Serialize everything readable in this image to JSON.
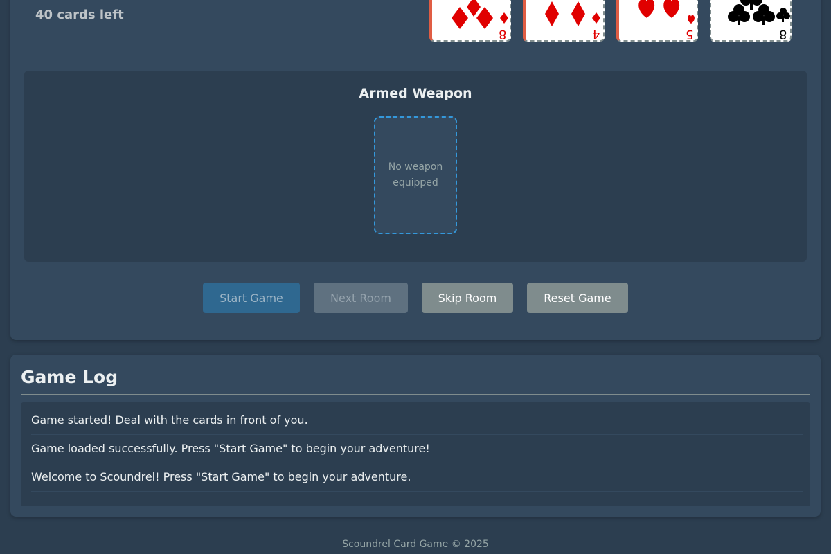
{
  "deck": {
    "count_label": "40 cards left"
  },
  "room": {
    "cards": [
      {
        "rank": "8",
        "suit": "diamonds",
        "color": "#e00000"
      },
      {
        "rank": "4",
        "suit": "diamonds",
        "color": "#e00000"
      },
      {
        "rank": "5",
        "suit": "hearts",
        "color": "#e00000"
      },
      {
        "rank": "8",
        "suit": "clubs",
        "color": "#000000"
      }
    ]
  },
  "weapon": {
    "title": "Armed Weapon",
    "empty_label": "No weapon equipped"
  },
  "controls": {
    "start": "Start Game",
    "next": "Next Room",
    "skip": "Skip Room",
    "reset": "Reset Game"
  },
  "log": {
    "title": "Game Log",
    "entries": [
      "Game started! Deal with the cards in front of you.",
      "Game loaded successfully. Press \"Start Game\" to begin your adventure!",
      "Welcome to Scoundrel! Press \"Start Game\" to begin your adventure."
    ]
  },
  "footer": {
    "text": "Scoundrel Card Game © 2025"
  },
  "colors": {
    "background": "#2c3e50",
    "panel": "#34495e",
    "accent": "#3498db",
    "red_suit": "#e00000",
    "black_suit": "#000000"
  }
}
